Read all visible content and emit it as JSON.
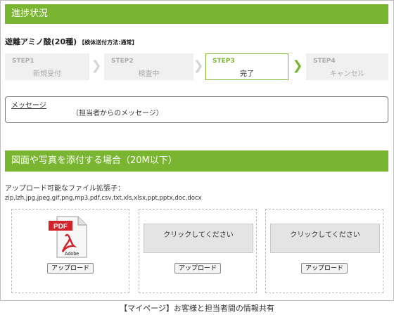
{
  "sections": {
    "progress_title": "進捗状況",
    "attach_title": "図面や写真を添付する場合（20M以下）"
  },
  "product": {
    "name": "遊離アミノ酸(20種)",
    "method": "【検体送付方法:通常】"
  },
  "steps": [
    {
      "num": "STEP1",
      "label": "新規受付",
      "active": false
    },
    {
      "num": "STEP2",
      "label": "検査中",
      "active": false
    },
    {
      "num": "STEP3",
      "label": "完了",
      "active": true
    },
    {
      "num": "STEP4",
      "label": "キャンセル",
      "active": false
    }
  ],
  "message": {
    "label": "メッセージ",
    "value": "（担当者からのメッセージ）"
  },
  "upload": {
    "extensions_title": "アップロード可能なファイル拡張子：",
    "extensions": "zip,lzh,jpg,jpeg,gif,png,mp3,pdf,csv,txt,xls,xlsx,ppt,pptx,doc,docx",
    "pdf_badge": "PDF",
    "adobe_label": "Adobe",
    "drop_label": "クリックしてください",
    "button_label": "アップロード"
  },
  "caption": "【マイページ】お客様と担当者間の情報共有",
  "colors": {
    "accent": "#7ab531",
    "step_inactive_bg": "#f0f0f0",
    "pdf_red": "#d2232a"
  },
  "icons": {
    "step_separator": "chevron-right-icon",
    "pdf": "pdf-file-icon"
  }
}
